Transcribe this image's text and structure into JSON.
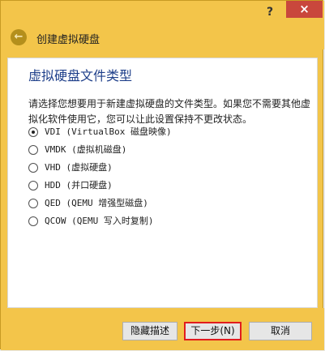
{
  "window": {
    "help_label": "?",
    "close_label": "×",
    "back_icon": "arrow-left",
    "wizard_title": "创建虚拟硬盘"
  },
  "page": {
    "title": "虚拟硬盘文件类型",
    "description": "请选择您想要用于新建虚拟硬盘的文件类型。如果您不需要其他虚拟化软件使用它，您可以让此设置保持不更改状态。",
    "options": [
      {
        "label": "VDI (VirtualBox 磁盘映像)",
        "selected": true
      },
      {
        "label": "VMDK (虚拟机磁盘)",
        "selected": false
      },
      {
        "label": "VHD (虚拟硬盘)",
        "selected": false
      },
      {
        "label": "HDD (并口硬盘)",
        "selected": false
      },
      {
        "label": "QED (QEMU 增强型磁盘)",
        "selected": false
      },
      {
        "label": "QCOW (QEMU 写入时复制)",
        "selected": false
      }
    ]
  },
  "buttons": {
    "hide_description": "隐藏描述",
    "next": "下一步(N)",
    "cancel": "取消"
  },
  "colors": {
    "window_chrome": "#f3c54a",
    "close_button": "#c9473c",
    "title_text": "#1e3f8a",
    "highlight_border": "#e21d1d"
  }
}
